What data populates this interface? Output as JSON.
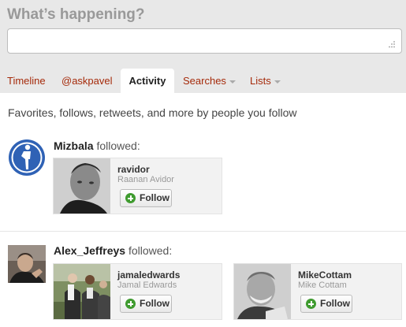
{
  "composer": {
    "prompt": "What’s happening?",
    "value": ""
  },
  "tabs": [
    {
      "label": "Timeline",
      "active": false
    },
    {
      "label": "@askpavel",
      "active": false
    },
    {
      "label": "Activity",
      "active": true
    },
    {
      "label": "Searches",
      "active": false,
      "dropdown": true
    },
    {
      "label": "Lists",
      "active": false,
      "dropdown": true
    }
  ],
  "activity": {
    "subtitle": "Favorites, follows, retweets, and more by people you follow",
    "events": [
      {
        "actor": "Mizbala",
        "action": "followed:",
        "avatar_icon": "person-figure-icon",
        "cards": [
          {
            "username": "ravidor",
            "realname": "Raanan Avidor",
            "follow_label": "Follow"
          }
        ]
      },
      {
        "actor": "Alex_Jeffreys",
        "action": "followed:",
        "avatar_icon": "profile-photo",
        "cards": [
          {
            "username": "jamaledwards",
            "realname": "Jamal Edwards",
            "follow_label": "Follow"
          },
          {
            "username": "MikeCottam",
            "realname": "Mike Cottam",
            "follow_label": "Follow"
          }
        ]
      }
    ]
  },
  "colors": {
    "tab_link": "#a52a0a",
    "follow_plus": "#3f9b2f",
    "header_bg": "#e8e8e8"
  }
}
